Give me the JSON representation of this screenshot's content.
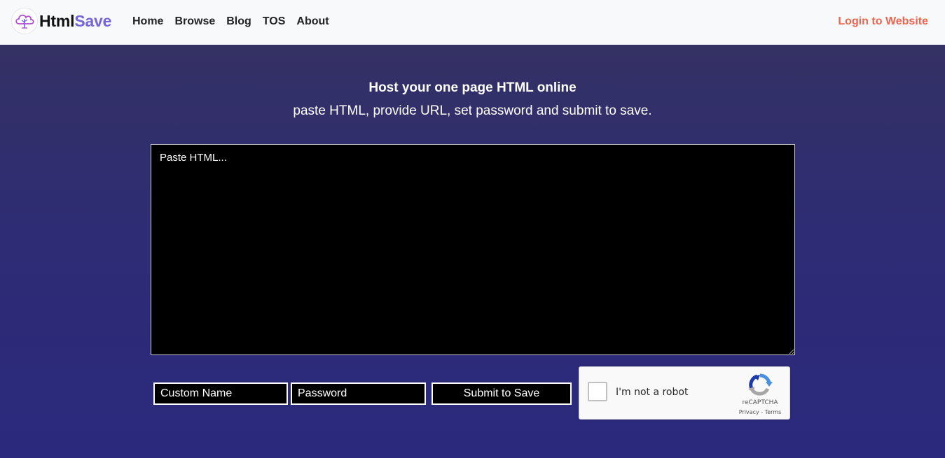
{
  "navbar": {
    "brand_part1": "Html",
    "brand_part2": "Save",
    "links": [
      "Home",
      "Browse",
      "Blog",
      "TOS",
      "About"
    ],
    "login": "Login to Website"
  },
  "hero": {
    "title": "Host your one page HTML online",
    "subtitle": "paste HTML, provide URL, set password and submit to save."
  },
  "form": {
    "html_placeholder": "Paste HTML...",
    "name_placeholder": "Custom Name",
    "password_placeholder": "Password",
    "submit_label": "Submit to Save"
  },
  "recaptcha": {
    "label": "I'm not a robot",
    "brand": "reCAPTCHA",
    "privacy": "Privacy",
    "separator": " - ",
    "terms": "Terms",
    "icon": "recaptcha-logo-icon"
  },
  "colors": {
    "brand_accent": "#7466d8",
    "login_link": "#f0644f",
    "hero_top": "#343164",
    "hero_bottom": "#2b297d"
  }
}
